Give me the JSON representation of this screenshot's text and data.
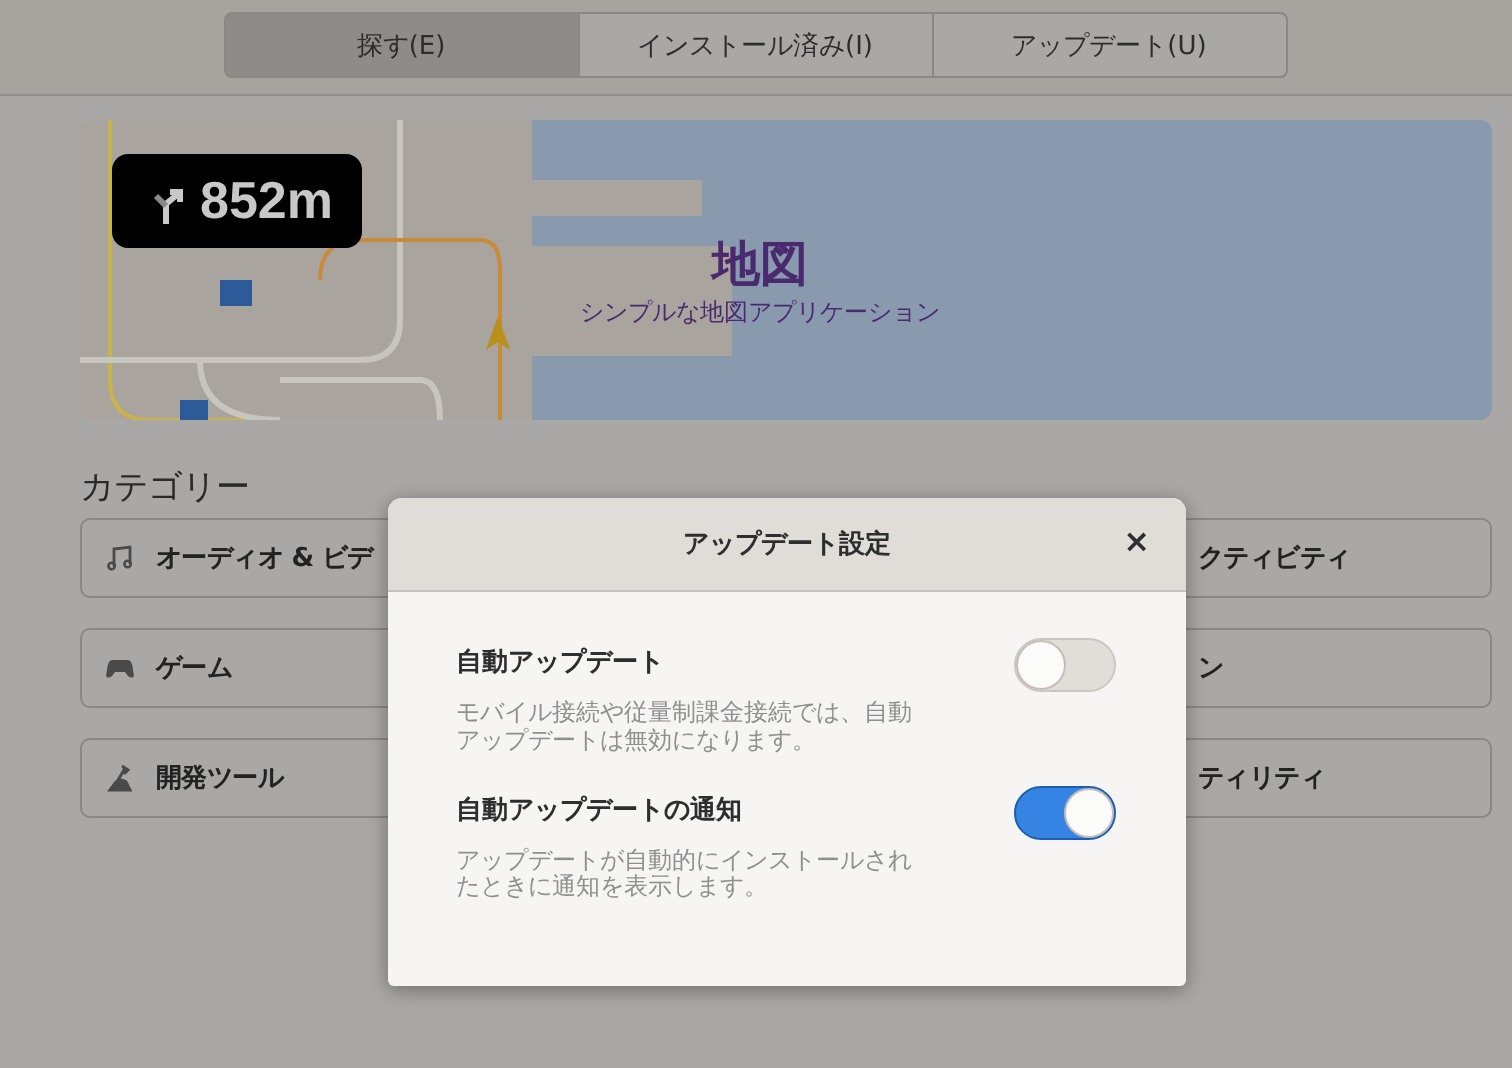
{
  "tabs": [
    {
      "label": "探す(E)",
      "selected": true
    },
    {
      "label": "インストール済み(I)",
      "selected": false
    },
    {
      "label": "アップデート(U)",
      "selected": false
    }
  ],
  "banner": {
    "distance": "852m",
    "title": "地図",
    "subtitle": "シンプルな地図アプリケーション"
  },
  "categories": {
    "heading": "カテゴリー",
    "items": [
      {
        "label": "オーディオ & ビデ",
        "kind": "music"
      },
      {
        "label": "クティビティ",
        "kind": "plain"
      },
      {
        "label": "ゲーム",
        "kind": "gamepad"
      },
      {
        "label": "ン",
        "kind": "plain"
      },
      {
        "label": "開発ツール",
        "kind": "tools"
      },
      {
        "label": "ティリティ",
        "kind": "plain"
      }
    ]
  },
  "dialog": {
    "title": "アップデート設定",
    "close": "×",
    "settings": [
      {
        "label": "自動アップデート",
        "description": "モバイル接続や従量制課金接続では、自動アップデートは無効になります。",
        "on": false
      },
      {
        "label": "自動アップデートの通知",
        "description": "アップデートが自動的にインストールされたときに通知を表示します。",
        "on": true
      }
    ]
  }
}
